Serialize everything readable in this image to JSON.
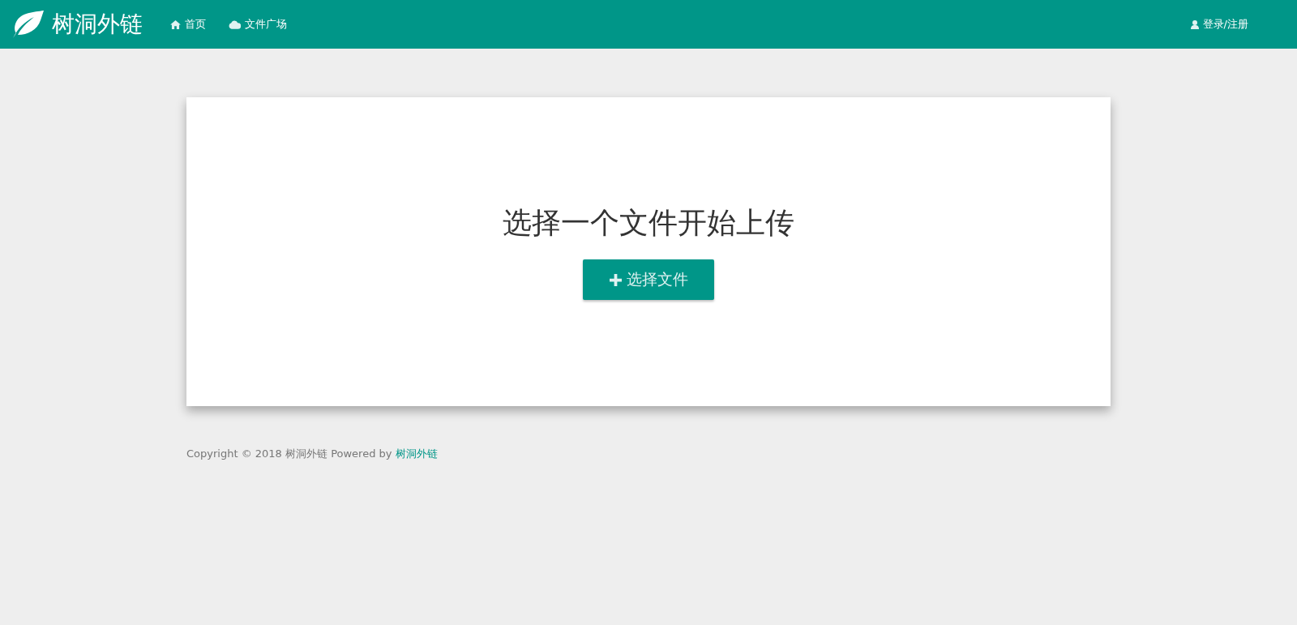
{
  "brand": {
    "name": "树洞外链"
  },
  "nav": [
    {
      "label": "首页",
      "kind": "home"
    },
    {
      "label": "文件广场",
      "kind": "cloud"
    }
  ],
  "user_link": {
    "label": "登录/注册"
  },
  "upload": {
    "heading": "选择一个文件开始上传",
    "button": "选择文件"
  },
  "footer": {
    "text": "Copyright © 2018 树洞外链 Powered by",
    "link": "树洞外链"
  }
}
